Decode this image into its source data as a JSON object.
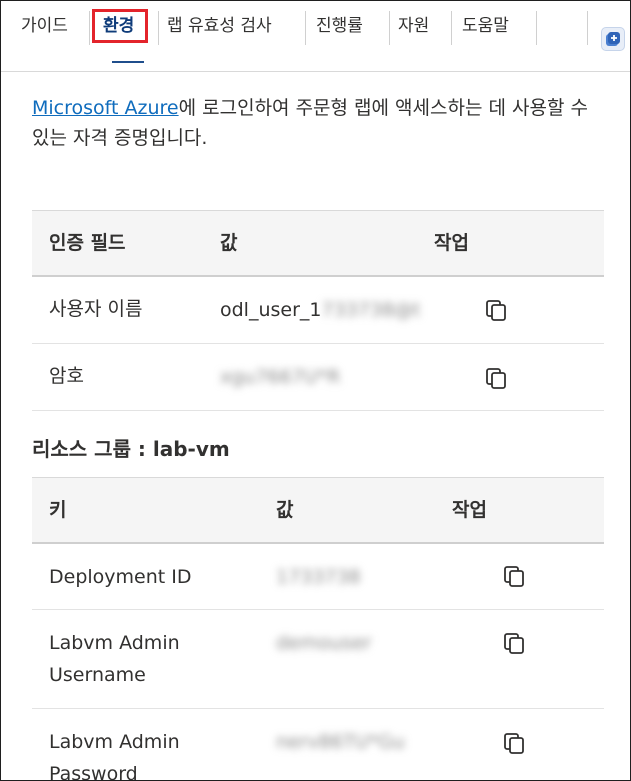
{
  "tabs": {
    "guide": "가이드",
    "environment": "환경",
    "lab_validation": "랩 유효성 검사",
    "progress": "진행률",
    "resources": "자원",
    "help": "도움말"
  },
  "intro": {
    "link_text": "Microsoft Azure",
    "text": "에 로그인하여 주문형 랩에 액세스하는 데 사용할 수 있는 자격 증명입니다."
  },
  "credentials_table": {
    "headers": [
      "인증 필드",
      "값",
      "작업"
    ],
    "rows": [
      {
        "field": "사용자 이름",
        "value": "odl_user_1",
        "value_hidden": "733738@t"
      },
      {
        "field": "암호",
        "value": "",
        "value_hidden": "xgu7667U*R"
      }
    ]
  },
  "resource_group": {
    "title": "리소스 그룹 : lab-vm",
    "headers": [
      "키",
      "값",
      "작업"
    ],
    "rows": [
      {
        "key": "Deployment ID",
        "value_hidden": "1733738"
      },
      {
        "key": "Labvm Admin Username",
        "value_hidden": "demouser"
      },
      {
        "key": "Labvm Admin Password",
        "value_hidden": "nerv86TU*Gu"
      }
    ]
  },
  "icons": {
    "copy": "copy-icon",
    "corner": "add-panel-icon"
  },
  "colors": {
    "accent": "#0f3c7a",
    "link": "#0f6cbd",
    "highlight": "#e3242b"
  }
}
